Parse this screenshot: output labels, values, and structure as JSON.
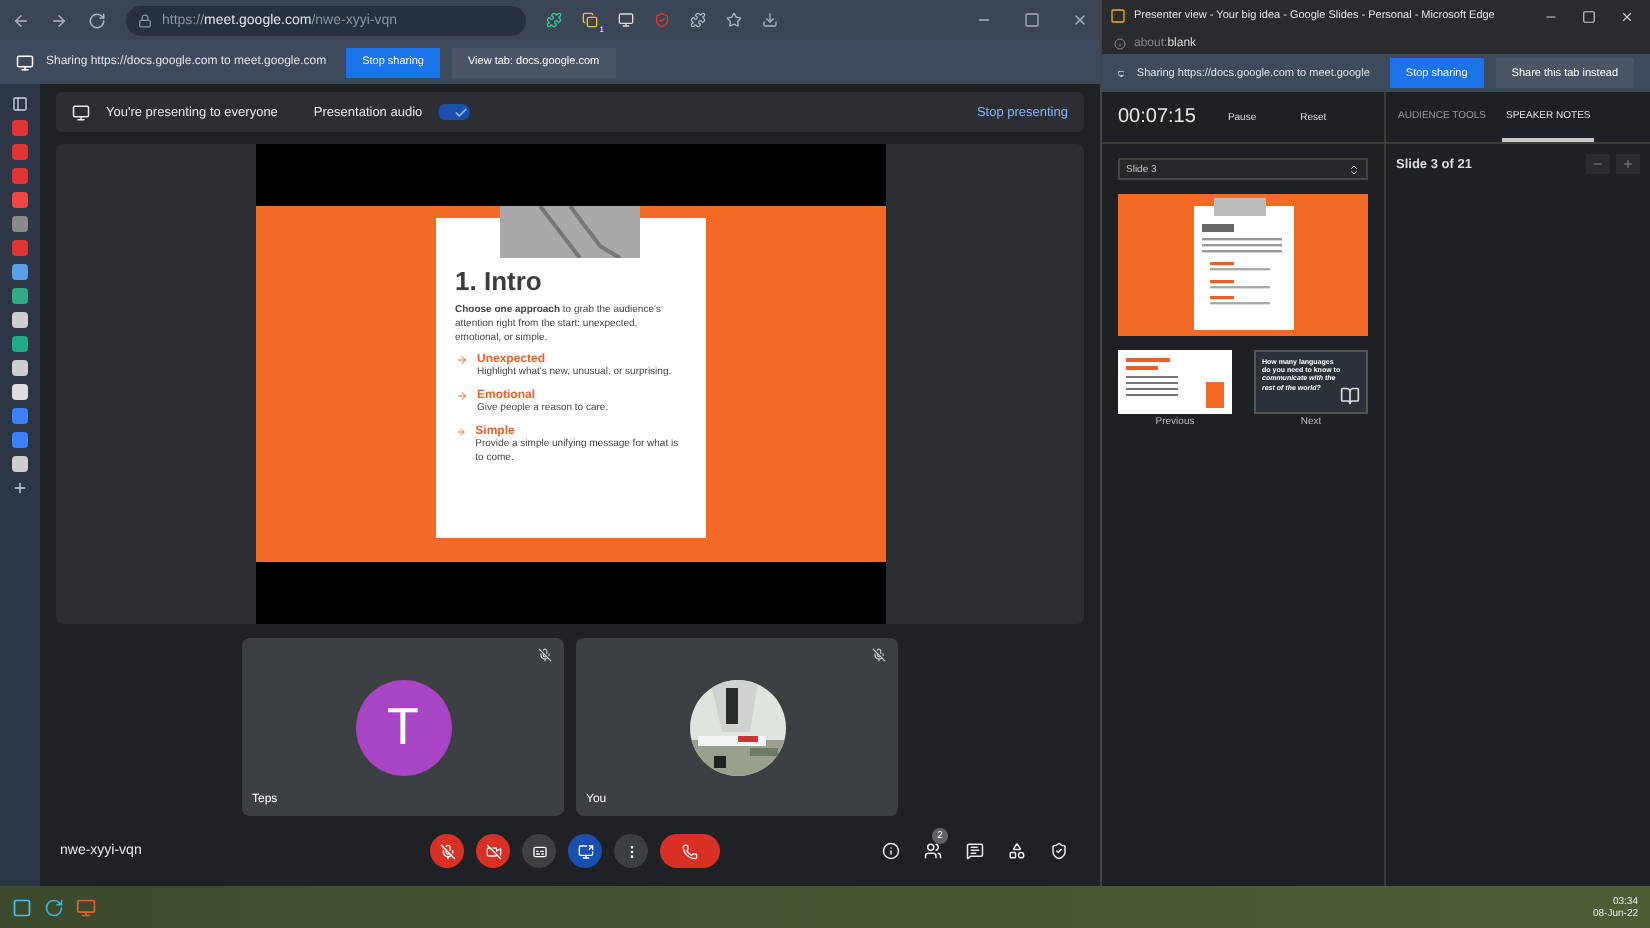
{
  "browser": {
    "url_scheme": "https://",
    "url_host": "meet.google.com",
    "url_path": "/nwe-xyyi-vqn",
    "extension_badge": "1"
  },
  "sharing_bar": {
    "text": "Sharing https://docs.google.com to meet.google.com",
    "buttons": [
      {
        "label": "Stop sharing",
        "kind": "primary"
      },
      {
        "label": "View tab: docs.google.com",
        "kind": "secondary"
      }
    ]
  },
  "presenting_bar": {
    "message": "You're presenting to everyone",
    "audio_label": "Presentation audio",
    "audio_on": true,
    "stop": "Stop presenting"
  },
  "slide": {
    "title": "1. Intro",
    "intro": "**Choose one approach** to grab the audience's attention right from the start: unexpected, emotional, or simple.",
    "points": [
      {
        "heading": "Unexpected",
        "text": "Highlight what's new, unusual, or surprising."
      },
      {
        "heading": "Emotional",
        "text": "Give people a reason to care."
      },
      {
        "heading": "Simple",
        "text": "Provide a simple unifying message for what is to come."
      }
    ]
  },
  "tiles": [
    {
      "name": "Teps",
      "muted": true,
      "avatar": {
        "kind": "letter",
        "letter": "T",
        "color": "#a845c4"
      }
    },
    {
      "name": "You",
      "muted": true
    }
  ],
  "meeting_code": "nwe-xyyi-vqn",
  "controls": [
    {
      "kind": "mic",
      "on": false
    },
    {
      "kind": "camera",
      "on": false
    },
    {
      "kind": "captions",
      "on": false
    },
    {
      "kind": "present",
      "on": true
    },
    {
      "kind": "more"
    },
    {
      "kind": "end"
    }
  ],
  "side_controls": [
    {
      "kind": "info"
    },
    {
      "kind": "people",
      "badge": "2"
    },
    {
      "kind": "chat"
    },
    {
      "kind": "activities"
    },
    {
      "kind": "host"
    }
  ],
  "presenter": {
    "title": "Presenter view - Your big idea - Google Slides - Personal - Microsoft Edge",
    "address_scheme": "about:",
    "address_rest": "blank",
    "sharing_text": "Sharing https://docs.google.com to meet.google",
    "buttons": [
      {
        "label": "Stop sharing",
        "kind": "primary"
      },
      {
        "label": "Share this tab instead",
        "kind": "secondary"
      }
    ],
    "timer": "00:07:15",
    "timer_buttons": [
      "Pause",
      "Reset"
    ],
    "slide_select": "Slide 3",
    "previous_label": "Previous",
    "next_label": "Next",
    "next_slide_text": "How many languages do you need to know to *communicate with the rest of the world?*",
    "tabs": [
      {
        "label": "AUDIENCE TOOLS",
        "selected": false
      },
      {
        "label": "SPEAKER NOTES",
        "selected": true
      }
    ],
    "slide_counter": "Slide 3 of 21"
  },
  "taskbar": {
    "time": "03:34",
    "date": "08-Jun-22"
  }
}
